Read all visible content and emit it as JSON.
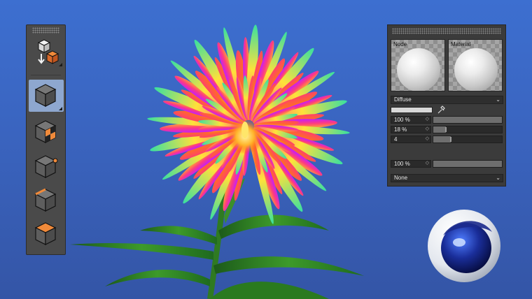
{
  "toolbar": {
    "tools": [
      {
        "name": "cube-mode-tool",
        "active": true
      },
      {
        "name": "checker-cube-tool",
        "active": false
      },
      {
        "name": "point-mode-tool",
        "active": false
      },
      {
        "name": "edge-mode-tool",
        "active": false
      },
      {
        "name": "polygon-mode-tool",
        "active": false
      }
    ]
  },
  "material_panel": {
    "previews": {
      "node_label": "Node",
      "material_label": "Material"
    },
    "channel_dropdown": "Diffuse",
    "fields": [
      {
        "value": "100 %",
        "fraction": 1.0
      },
      {
        "value": "18 %",
        "fraction": 0.18
      },
      {
        "value": "4",
        "fraction": 0.25
      }
    ],
    "mix_field": {
      "value": "100 %",
      "fraction": 1.0
    },
    "blend_dropdown": "None",
    "chevron": "⌄",
    "spin": "◇"
  },
  "colors": {
    "background_top": "#3d6fd0",
    "background_bottom": "#3455a6",
    "panel_bg": "#3b3b3b",
    "accent_orange": "#f08a3a",
    "active_tool": "#8ea7cf"
  }
}
